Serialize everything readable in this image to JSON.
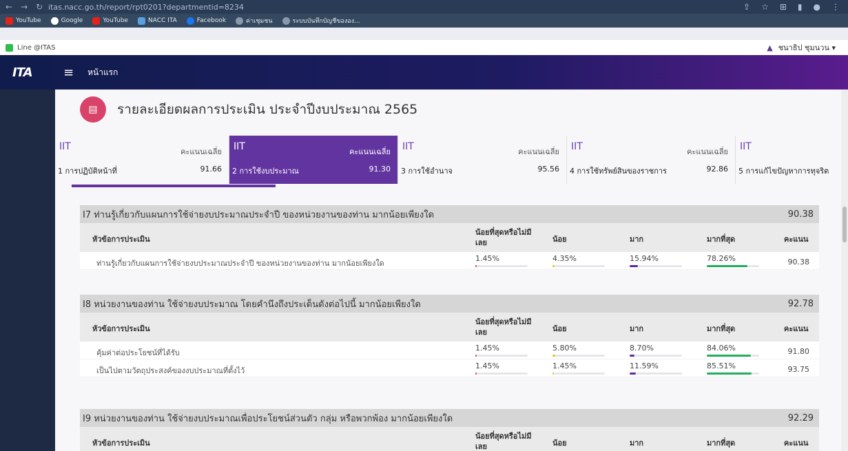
{
  "browser": {
    "url": "itas.nacc.go.th/report/rpt0201?departmentid=8234",
    "bookmarks": [
      "YouTube",
      "Google",
      "YouTube",
      "NACC ITA",
      "Facebook",
      "ค่าเชุมชน",
      "ระบบบันทึกบัญชีขององ..."
    ]
  },
  "topbar": {
    "line_link": "Line @ITAS",
    "user_name": "ชนาธิป ชุมนวน ▾"
  },
  "header": {
    "logo": "ITA",
    "home": "หน้าแรก"
  },
  "page_title": "รายละเอียดผลการประเมิน ประจำปีงบประมาณ 2565",
  "tabs": [
    {
      "iit": "IIT",
      "avg_label": "คะแนนเฉลี่ย",
      "name": "1 การปฏิบัติหน้าที่",
      "score": "91.66"
    },
    {
      "iit": "IIT",
      "avg_label": "คะแนนเฉลี่ย",
      "name": "2 การใช้งบประมาณ",
      "score": "91.30"
    },
    {
      "iit": "IIT",
      "avg_label": "คะแนนเฉลี่ย",
      "name": "3 การใช้อำนาจ",
      "score": "95.56"
    },
    {
      "iit": "IIT",
      "avg_label": "คะแนนเฉลี่ย",
      "name": "4 การใช้ทรัพย์สินของราชการ",
      "score": "92.86"
    },
    {
      "iit": "IIT",
      "avg_label": "",
      "name": "5 การแก้ไขปัญหาการทุจริต",
      "score": ""
    }
  ],
  "table_headers": {
    "topic": "หัวข้อการประเมิน",
    "least": "น้อยที่สุดหรือไม่มีเลย",
    "little": "น้อย",
    "much": "มาก",
    "most": "มากที่สุด",
    "score": "คะแนน"
  },
  "colors": {
    "least": "#d9436a",
    "little": "#f0c419",
    "much": "#5a2aa8",
    "most": "#1fae5b"
  },
  "questions": [
    {
      "title": "I7 ท่านรู้เกี่ยวกับแผนการใช้จ่ายงบประมาณประจำปี ของหน่วยงานของท่าน มากน้อยเพียงใด",
      "score": "90.38",
      "rows": [
        {
          "text": "ท่านรู้เกี่ยวกับแผนการใช้จ่ายงบประมาณประจำปี ของหน่วยงานของท่าน มากน้อยเพียงใด",
          "least": "1.45%",
          "little": "4.35%",
          "much": "15.94%",
          "most": "78.26%",
          "score": "90.38"
        }
      ]
    },
    {
      "title": "I8 หน่วยงานของท่าน ใช้จ่ายงบประมาณ โดยคำนึงถึงประเด็นดังต่อไปนี้ มากน้อยเพียงใด",
      "score": "92.78",
      "rows": [
        {
          "text": "คุ้มค่าต่อประโยชน์ที่ได้รับ",
          "least": "1.45%",
          "little": "5.80%",
          "much": "8.70%",
          "most": "84.06%",
          "score": "91.80"
        },
        {
          "text": "เป็นไปตามวัตถุประสงค์ของงบประมาณที่ตั้งไว้",
          "least": "1.45%",
          "little": "1.45%",
          "much": "11.59%",
          "most": "85.51%",
          "score": "93.75"
        }
      ]
    },
    {
      "title": "I9 หน่วยงานของท่าน ใช้จ่ายงบประมาณเพื่อประโยชน์ส่วนตัว กลุ่ม หรือพวกพ้อง มากน้อยเพียงใด",
      "score": "92.29",
      "rows": []
    }
  ]
}
